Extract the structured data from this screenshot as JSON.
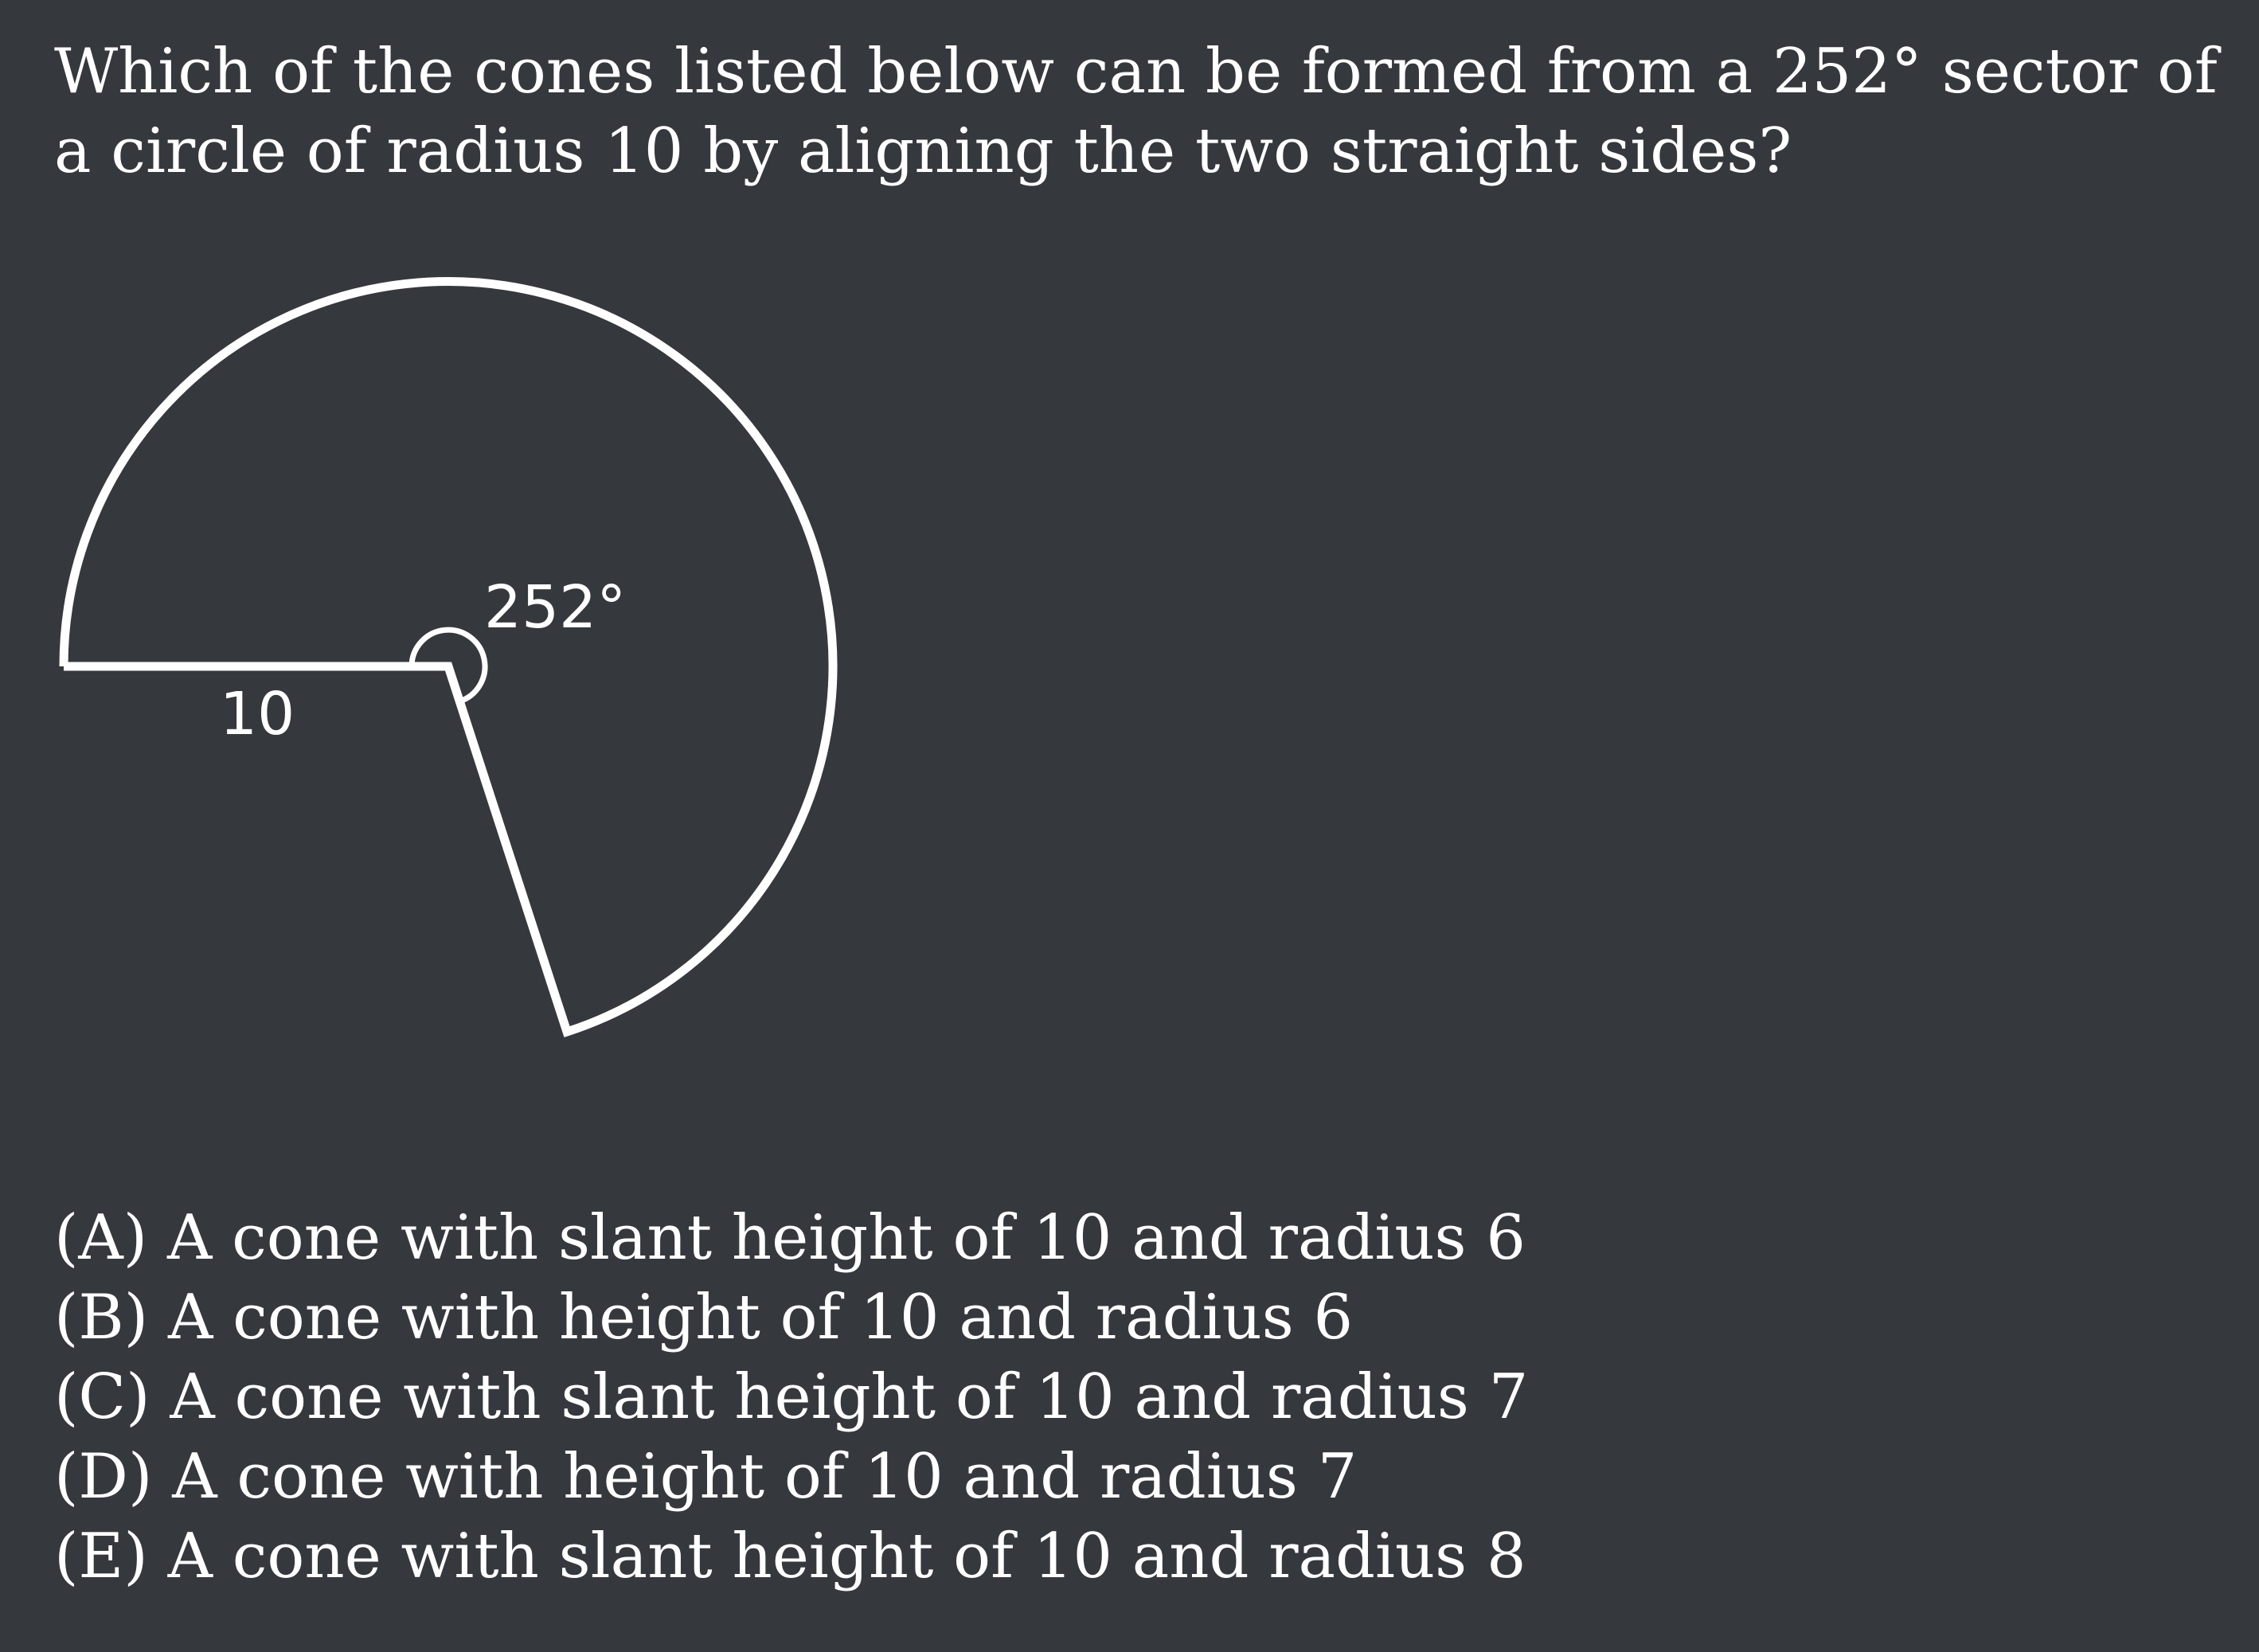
{
  "question": {
    "text": "Which of the cones listed below can be formed from a 252° sector of a circle of radius 10 by aligning the two straight sides?"
  },
  "figure": {
    "angle_label": "252°",
    "radius_label": "10",
    "sector_angle_deg": 252,
    "radius_value": 10,
    "stroke_color": "#ffffff",
    "background_color": "#35383d"
  },
  "choices": [
    "(A) A cone with slant height of 10 and radius 6",
    "(B) A cone with height of 10 and radius 6",
    "(C) A cone with slant height of 10 and radius 7",
    "(D) A cone with height of 10 and radius 7",
    "(E) A cone with slant height of 10 and radius 8"
  ]
}
